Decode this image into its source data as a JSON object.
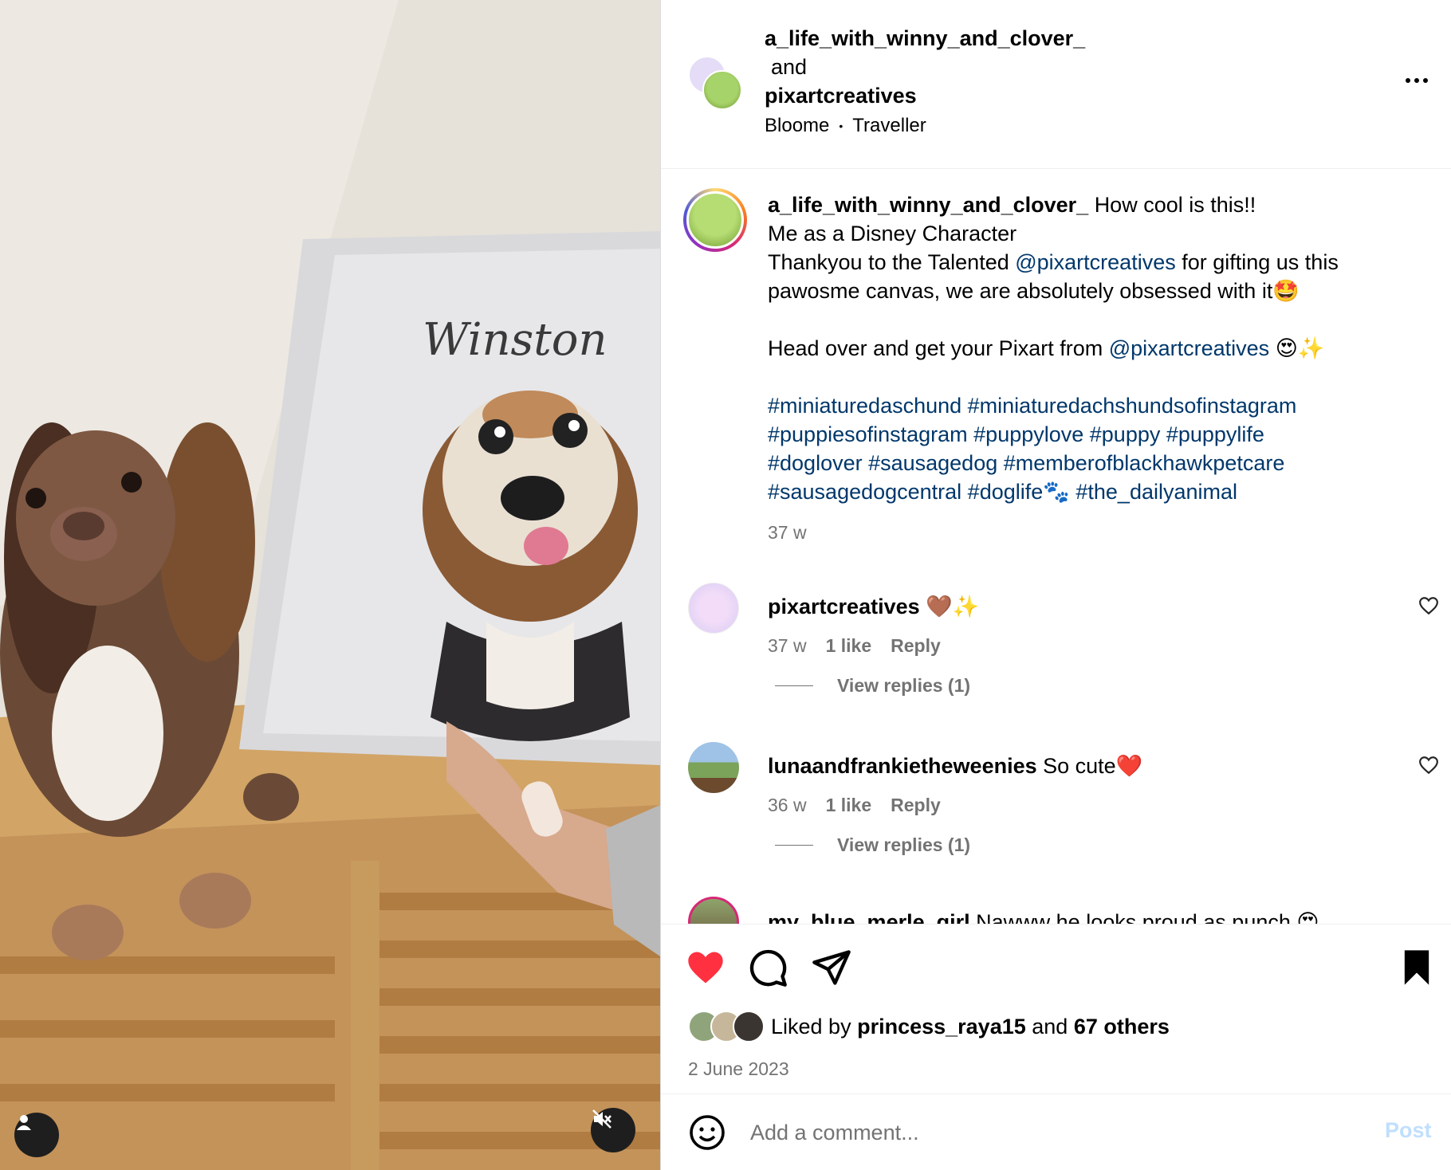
{
  "post": {
    "author": "a_life_with_winny_and_clover_",
    "and_word": "and",
    "collaborator": "pixartcreatives",
    "audio_artist": "Bloome",
    "audio_separator": "•",
    "audio_title": "Traveller",
    "media_painting_name": "Winston"
  },
  "caption": {
    "user": "a_life_with_winny_and_clover_",
    "line1": "How cool is this!!",
    "line2": "Me as a Disney Character",
    "line3_pre": "Thankyou to the Talented ",
    "mention": "@pixartcreatives",
    "line3_post": " for gifting us this",
    "line4": "pawosme canvas, we are absolutely obsessed with it🤩",
    "line5_pre": "Head over and get your Pixart from ",
    "mention2": "@pixartcreatives",
    "line5_post": " 😍✨",
    "tags_line1": "#miniaturedaschund #miniaturedachshundsofinstagram",
    "tags_line2": "#puppiesofinstagram #puppylove #puppy #puppylife",
    "tags_line3": "#doglover #sausagedog #memberofblackhawkpetcare",
    "tags_line4": "#sausagedogcentral #doglife🐾 #the_dailyanimal",
    "time": "37 w"
  },
  "comments": [
    {
      "user": "pixartcreatives",
      "text": "🤎✨",
      "time": "37 w",
      "likes": "1 like",
      "reply": "Reply",
      "view_replies": "View replies (1)"
    },
    {
      "user": "lunaandfrankietheweenies",
      "text": "So cute❤️",
      "time": "36 w",
      "likes": "1 like",
      "reply": "Reply",
      "view_replies": "View replies (1)"
    },
    {
      "user": "my_blue_merle_girl",
      "text": "Nawww he looks proud as punch 😍"
    }
  ],
  "likes": {
    "prefix": "Liked by ",
    "user": "princess_raya15",
    "middle": " and ",
    "others": "67 others"
  },
  "date": "2 June 2023",
  "comment_box": {
    "placeholder": "Add a comment...",
    "post_label": "Post"
  },
  "colors": {
    "like_red": "#ff3040",
    "link_blue": "#00376b",
    "muted": "#737373",
    "post_disabled": "#c0dffd"
  },
  "icons": {
    "more": "more-horizontal-icon",
    "heart_filled": "heart-filled-icon",
    "comment": "comment-bubble-icon",
    "share": "paper-plane-icon",
    "save": "bookmark-filled-icon",
    "emoji": "smiley-icon",
    "mute": "speaker-muted-icon",
    "tagged_user": "user-icon"
  }
}
